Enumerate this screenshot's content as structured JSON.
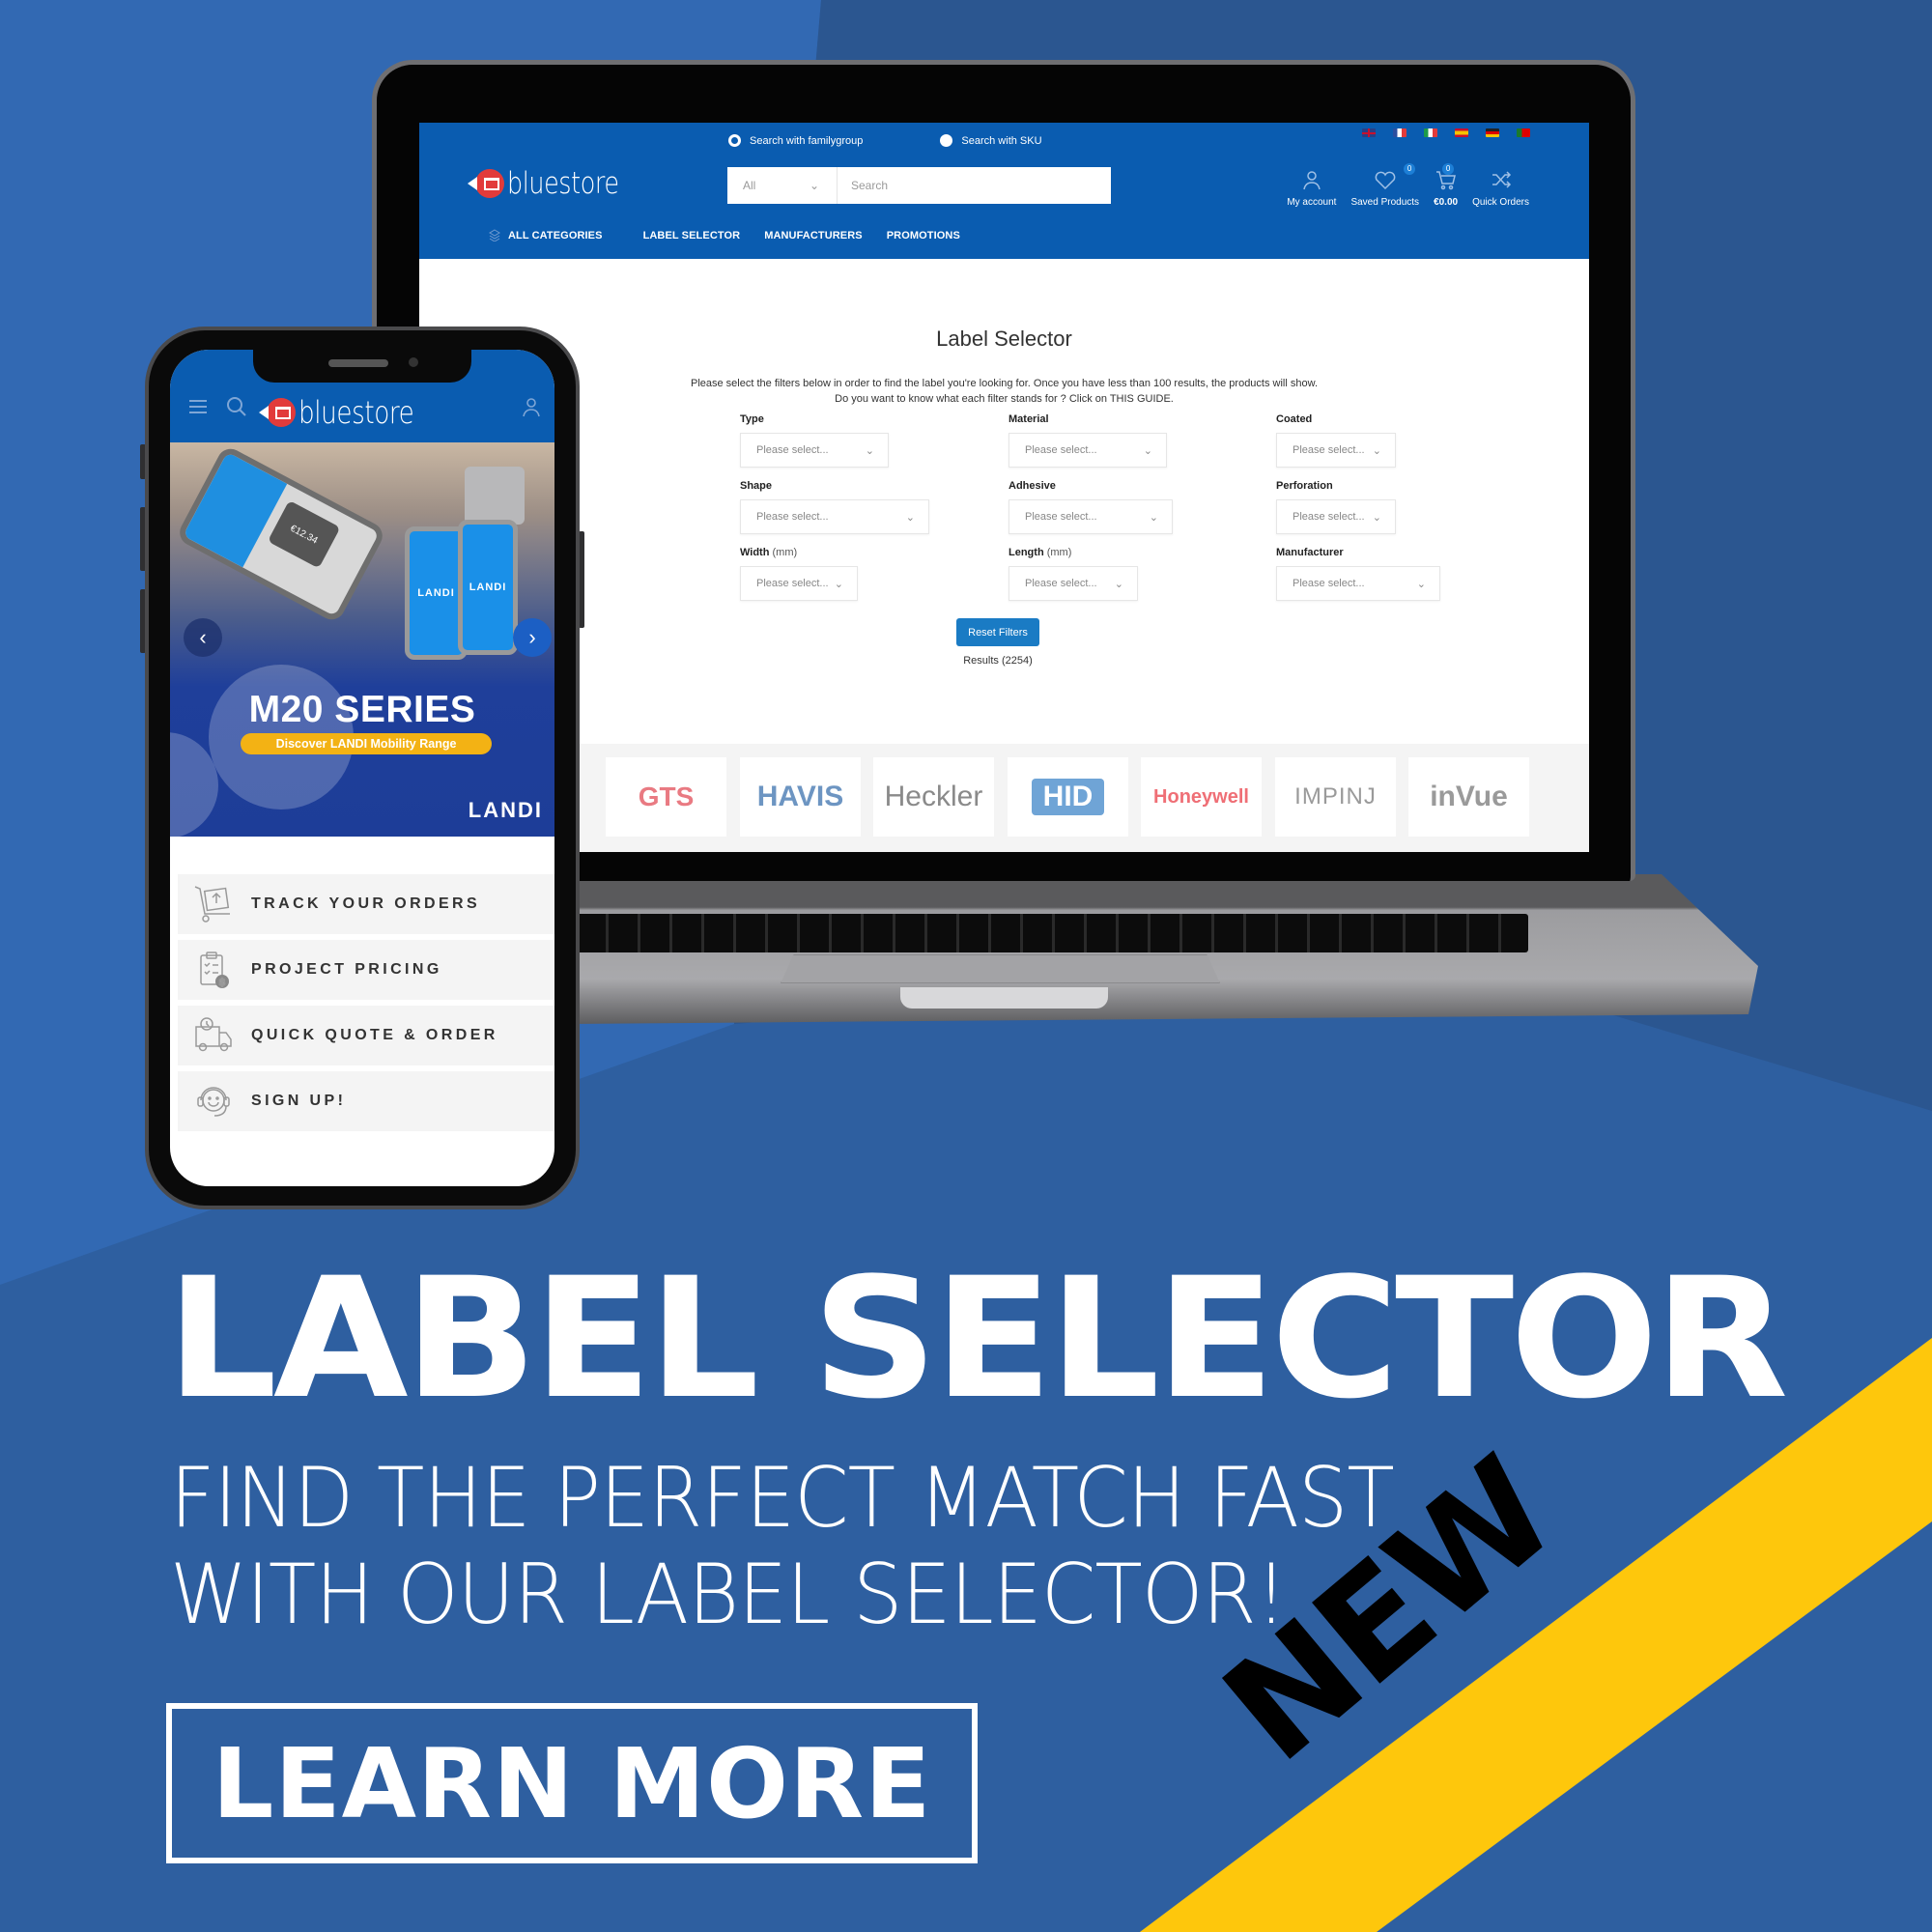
{
  "colors": {
    "background": "#2e5fa0",
    "site_blue": "#0a5cb0",
    "ribbon_yellow": "#fec70c",
    "button_blue": "#1a7bc4",
    "banner_pill": "#f3b214"
  },
  "laptop": {
    "site": {
      "brand": "bluestore",
      "language_flags": [
        "uk-flag-icon",
        "france-flag-icon",
        "italy-flag-icon",
        "spain-flag-icon",
        "germany-flag-icon",
        "portugal-flag-icon"
      ],
      "search_modes": [
        {
          "label": "Search with familygroup",
          "selected": false
        },
        {
          "label": "Search with SKU",
          "selected": true
        }
      ],
      "search": {
        "category_value": "All",
        "placeholder": "Search"
      },
      "header_actions": [
        {
          "label": "My account",
          "icon": "user-icon"
        },
        {
          "label": "Saved Products",
          "icon": "heart-icon",
          "badge": "0"
        },
        {
          "label": "€0.00",
          "icon": "cart-icon",
          "badge": "0"
        },
        {
          "label": "Quick Orders",
          "icon": "shuffle-icon"
        }
      ],
      "nav": [
        "ALL CATEGORIES",
        "LABEL SELECTOR",
        "MANUFACTURERS",
        "PROMOTIONS"
      ]
    },
    "page": {
      "title": "Label Selector",
      "description_line1": "Please select the filters below in order to find the label you're looking for. Once you have less than 100 results, the products will show.",
      "description_line2": "Do you want to know what each filter stands for ? Click on THIS GUIDE.",
      "filters": [
        {
          "label": "Type",
          "unit": "",
          "placeholder": "Please select..."
        },
        {
          "label": "Material",
          "unit": "",
          "placeholder": "Please select..."
        },
        {
          "label": "Coated",
          "unit": "",
          "placeholder": "Please select..."
        },
        {
          "label": "Shape",
          "unit": "",
          "placeholder": "Please select..."
        },
        {
          "label": "Adhesive",
          "unit": "",
          "placeholder": "Please select..."
        },
        {
          "label": "Perforation",
          "unit": "",
          "placeholder": "Please select..."
        },
        {
          "label": "Width",
          "unit": "(mm)",
          "placeholder": "Please select..."
        },
        {
          "label": "Length",
          "unit": "(mm)",
          "placeholder": "Please select..."
        },
        {
          "label": "Manufacturer",
          "unit": "",
          "placeholder": "Please select..."
        }
      ],
      "reset_label": "Reset Filters",
      "results_text": "Results (2254)",
      "brands": [
        "GTS",
        "HAVIS",
        "Heckler",
        "HID",
        "Honeywell",
        "IMPINJ",
        "inVue"
      ]
    }
  },
  "phone": {
    "brand": "bluestore",
    "banner": {
      "title": "M20 SERIES",
      "pill": "Discover LANDI Mobility Range",
      "device_brand": "LANDI",
      "logo": "LANDI",
      "payment_amount": "€12.34"
    },
    "menu": [
      {
        "label": "TRACK YOUR ORDERS",
        "icon": "cart-upload-icon"
      },
      {
        "label": "PROJECT PRICING",
        "icon": "clipboard-dollar-icon"
      },
      {
        "label": "QUICK QUOTE & ORDER",
        "icon": "delivery-truck-icon"
      },
      {
        "label": "SIGN UP!",
        "icon": "headset-agent-icon"
      }
    ]
  },
  "promo": {
    "headline": "LABEL SELECTOR",
    "subline1": "FIND THE PERFECT MATCH FAST",
    "subline2": "WITH OUR LABEL SELECTOR!",
    "cta": "LEARN MORE",
    "ribbon": "NEW"
  }
}
